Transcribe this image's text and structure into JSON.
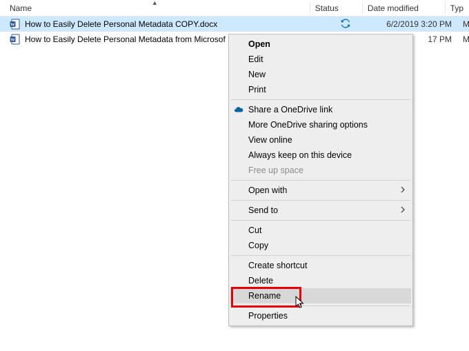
{
  "columns": {
    "name": "Name",
    "status": "Status",
    "date": "Date modified",
    "type": "Typ"
  },
  "sort_indicator": "▲",
  "files": [
    {
      "name": "How to Easily Delete Personal Metadata COPY.docx",
      "status_icon": "sync",
      "date": "6/2/2019 3:20 PM",
      "type": "Mi",
      "selected": true
    },
    {
      "name": "How to Easily Delete Personal Metadata from Microsof",
      "status_icon": "",
      "date": "17 PM",
      "type": "Mi",
      "selected": false
    }
  ],
  "menu": {
    "open": "Open",
    "edit": "Edit",
    "new": "New",
    "print": "Print",
    "share_onedrive": "Share a OneDrive link",
    "more_onedrive": "More OneDrive sharing options",
    "view_online": "View online",
    "always_keep": "Always keep on this device",
    "free_up": "Free up space",
    "open_with": "Open with",
    "send_to": "Send to",
    "cut": "Cut",
    "copy": "Copy",
    "create_shortcut": "Create shortcut",
    "delete": "Delete",
    "rename": "Rename",
    "properties": "Properties"
  }
}
